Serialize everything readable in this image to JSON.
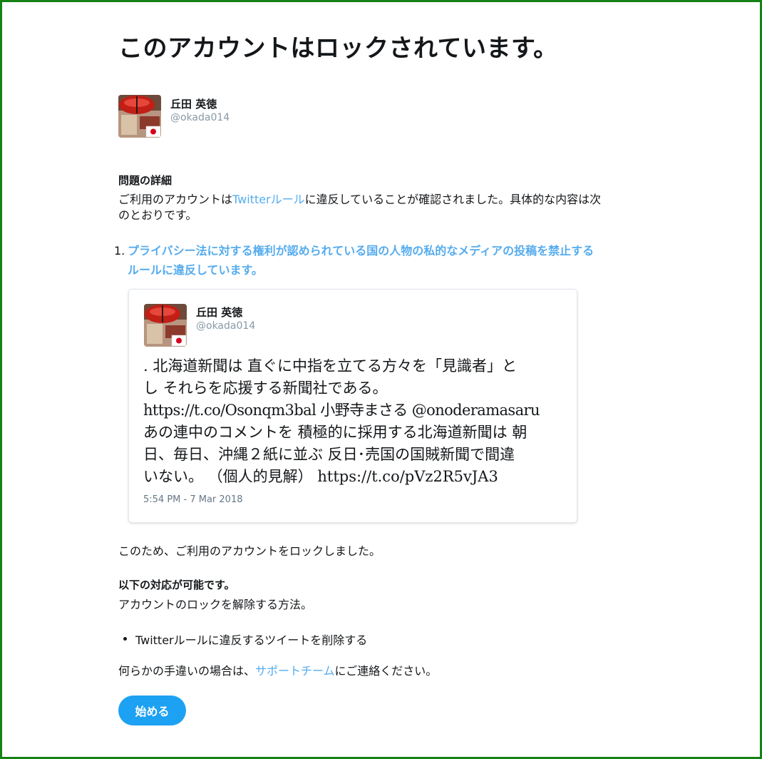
{
  "page": {
    "title": "このアカウントはロックされています。"
  },
  "profile": {
    "name": "丘田 英徳",
    "handle": "@okada014"
  },
  "details": {
    "heading": "問題の詳細",
    "line1_pre": "ご利用のアカウントは",
    "line1_link": "Twitterルール",
    "line1_post": "に違反していることが確認されました。具体的な内容は次",
    "line2": "のとおりです。"
  },
  "rule": {
    "number": "1.",
    "line1": "プライバシー法に対する権利が認められている国の人物の私的なメディアの投稿を禁止する",
    "line2": "ルールに違反しています。"
  },
  "tweet": {
    "name": "丘田 英徳",
    "handle": "@okada014",
    "lines": [
      ". 北海道新聞は 直ぐに中指を立てる方々を「見識者」と",
      "し それらを応援する新聞社である。",
      "https://t.co/Osonqm3bal 小野寺まさる @onoderamasaru",
      "あの連中のコメントを 積極的に採用する北海道新聞は 朝",
      "日、毎日、沖縄２紙に並ぶ 反日･売国の国賊新聞で間違",
      "いない。 （個人的見解） https://t.co/pVz2R5vJA3"
    ],
    "timestamp": "5:54 PM - 7 Mar 2018"
  },
  "locked_notice": "このため、ご利用のアカウントをロックしました。",
  "actions": {
    "heading": "以下の対応が可能です。",
    "subtext": "アカウントのロックを解除する方法。",
    "bullet": "Twitterルールに違反するツイートを削除する"
  },
  "support": {
    "pre": "何らかの手違いの場合は、",
    "link": "サポートチーム",
    "post": "にご連絡ください。"
  },
  "button": {
    "label": "始める"
  },
  "colors": {
    "link": "#55acee",
    "button": "#1da1f2",
    "frame": "#148214"
  }
}
